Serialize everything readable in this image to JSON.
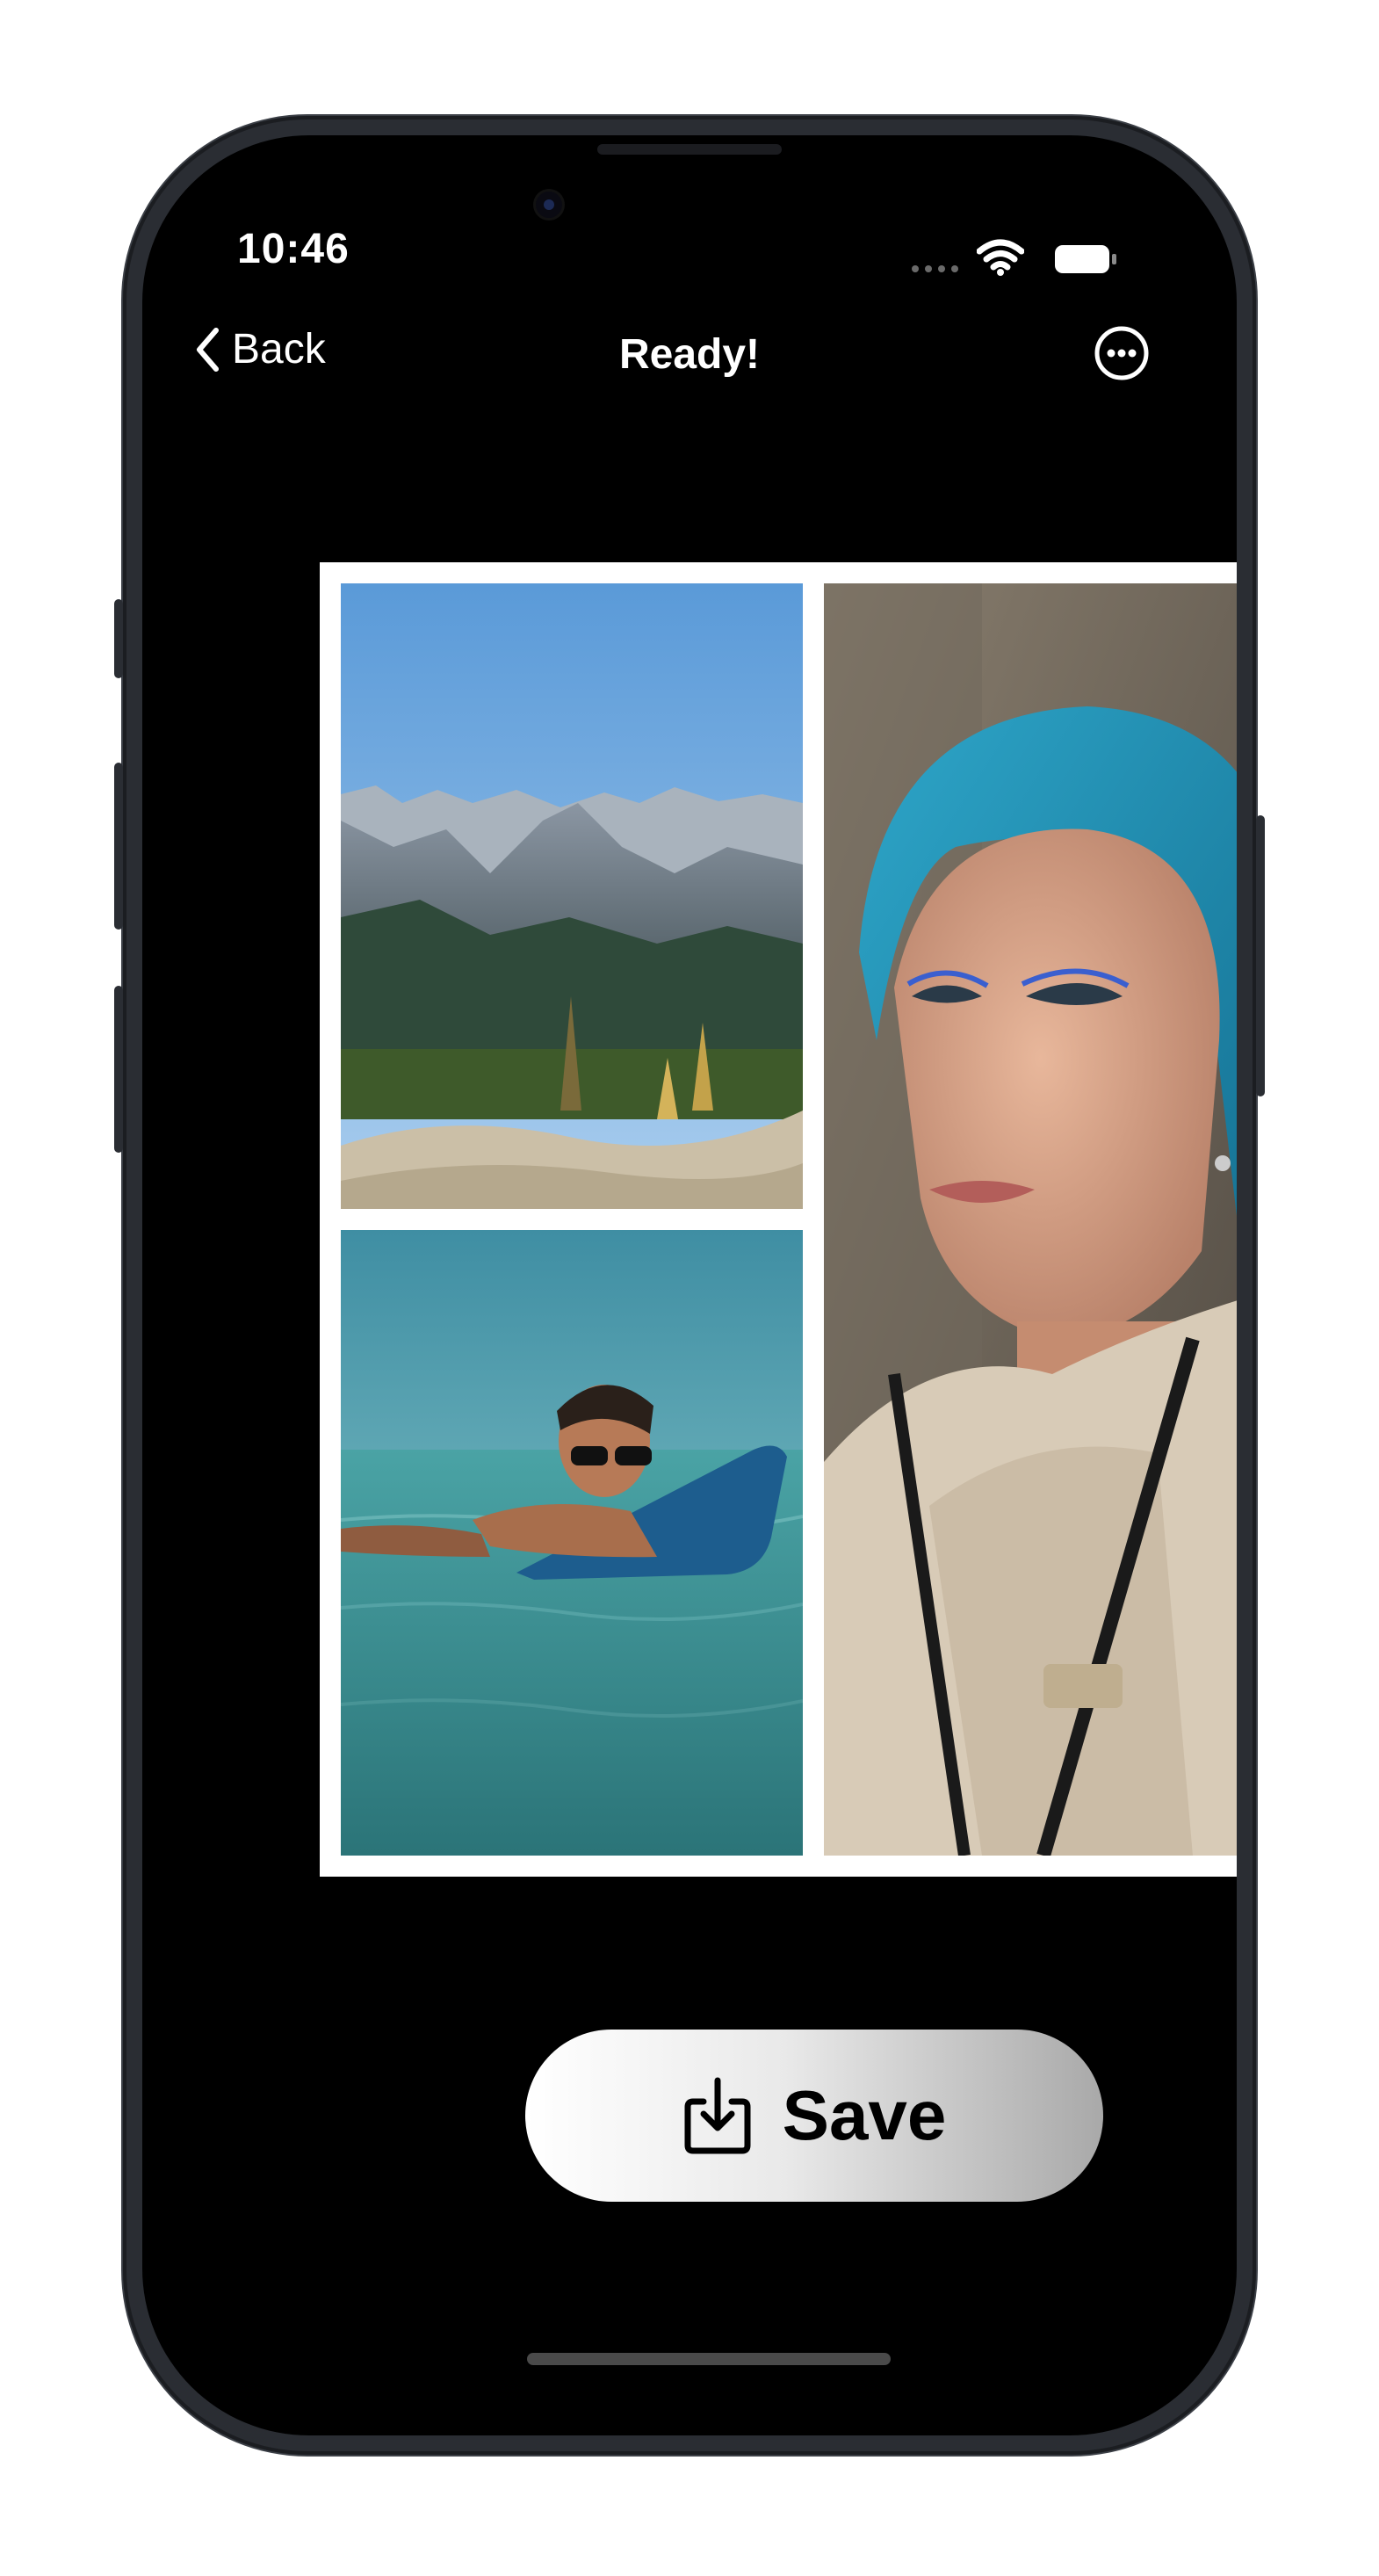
{
  "status_bar": {
    "time": "10:46",
    "icons": [
      "cellular-signal-icon",
      "wifi-icon",
      "battery-icon"
    ]
  },
  "nav": {
    "back_label": "Back",
    "title": "Ready!",
    "more_icon": "ellipsis-circle-icon"
  },
  "collage": {
    "layout": "two-left-one-right",
    "photos": [
      {
        "subject": "mountain landscape"
      },
      {
        "subject": "man on surfboard"
      },
      {
        "subject": "woman with blue hair"
      }
    ]
  },
  "save_button": {
    "label": "Save",
    "icon": "download-icon"
  },
  "colors": {
    "background": "#000000",
    "text": "#ffffff",
    "collage_border": "#ffffff",
    "button_gradient_start": "#ffffff",
    "button_gradient_end": "#a9a9a9"
  }
}
